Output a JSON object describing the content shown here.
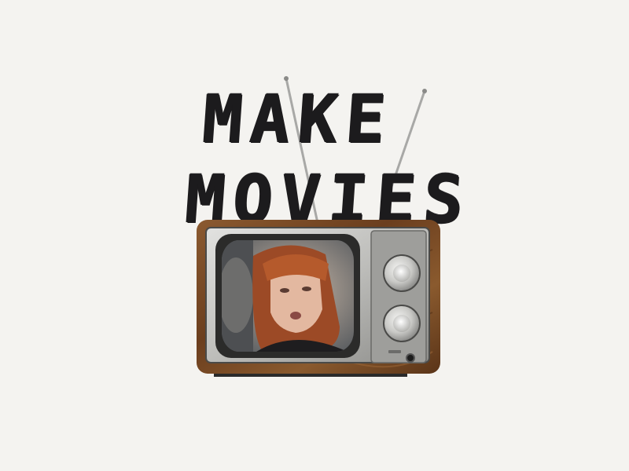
{
  "title": {
    "line1": "MAKE",
    "line2": "MOVIES"
  },
  "icons": {
    "tv": "vintage-tv-icon",
    "antenna": "antenna-icon",
    "channel_knob": "knob-icon",
    "volume_knob": "knob-icon",
    "power": "power-indicator-icon"
  },
  "colors": {
    "background": "#f4f3f0",
    "ink": "#1c1b1d",
    "wood": "#7a4a26",
    "chrome": "#c9c9c6"
  }
}
